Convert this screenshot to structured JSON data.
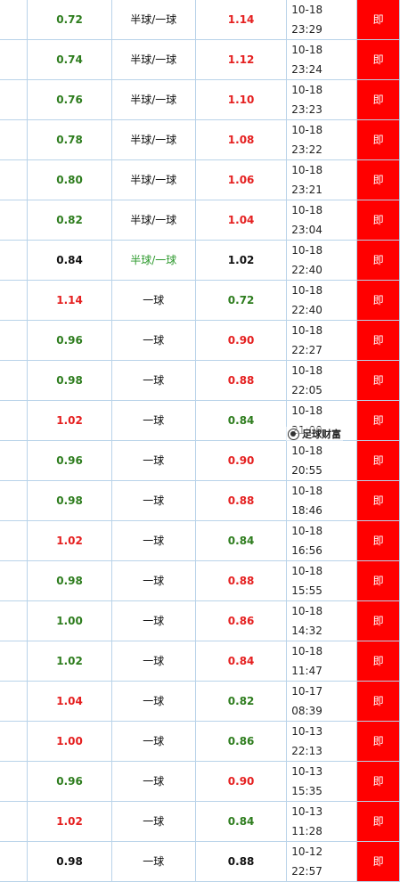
{
  "rows": [
    {
      "home": "0.72",
      "home_color": "green",
      "handicap": "半球/一球",
      "handicap_color": "black",
      "away": "1.14",
      "away_color": "red",
      "time": "10-18 23:29",
      "action": "即"
    },
    {
      "home": "0.74",
      "home_color": "green",
      "handicap": "半球/一球",
      "handicap_color": "black",
      "away": "1.12",
      "away_color": "red",
      "time": "10-18 23:24",
      "action": "即"
    },
    {
      "home": "0.76",
      "home_color": "green",
      "handicap": "半球/一球",
      "handicap_color": "black",
      "away": "1.10",
      "away_color": "red",
      "time": "10-18 23:23",
      "action": "即"
    },
    {
      "home": "0.78",
      "home_color": "green",
      "handicap": "半球/一球",
      "handicap_color": "black",
      "away": "1.08",
      "away_color": "red",
      "time": "10-18 23:22",
      "action": "即"
    },
    {
      "home": "0.80",
      "home_color": "green",
      "handicap": "半球/一球",
      "handicap_color": "black",
      "away": "1.06",
      "away_color": "red",
      "time": "10-18 23:21",
      "action": "即"
    },
    {
      "home": "0.82",
      "home_color": "green",
      "handicap": "半球/一球",
      "handicap_color": "black",
      "away": "1.04",
      "away_color": "red",
      "time": "10-18 23:04",
      "action": "即"
    },
    {
      "home": "0.84",
      "home_color": "black",
      "handicap": "半球/一球",
      "handicap_color": "green",
      "away": "1.02",
      "away_color": "black",
      "time": "10-18 22:40",
      "action": "即"
    },
    {
      "home": "1.14",
      "home_color": "red",
      "handicap": "一球",
      "handicap_color": "black",
      "away": "0.72",
      "away_color": "green",
      "time": "10-18 22:40",
      "action": "即"
    },
    {
      "home": "0.96",
      "home_color": "green",
      "handicap": "一球",
      "handicap_color": "black",
      "away": "0.90",
      "away_color": "red",
      "time": "10-18 22:27",
      "action": "即"
    },
    {
      "home": "0.98",
      "home_color": "green",
      "handicap": "一球",
      "handicap_color": "black",
      "away": "0.88",
      "away_color": "red",
      "time": "10-18 22:05",
      "action": "即"
    },
    {
      "home": "1.02",
      "home_color": "red",
      "handicap": "一球",
      "handicap_color": "black",
      "away": "0.84",
      "away_color": "green",
      "time": "10-18 21:00",
      "action": "即"
    },
    {
      "home": "0.96",
      "home_color": "green",
      "handicap": "一球",
      "handicap_color": "black",
      "away": "0.90",
      "away_color": "red",
      "time": "10-18 20:55",
      "action": "即"
    },
    {
      "home": "0.98",
      "home_color": "green",
      "handicap": "一球",
      "handicap_color": "black",
      "away": "0.88",
      "away_color": "red",
      "time": "10-18 18:46",
      "action": "即"
    },
    {
      "home": "1.02",
      "home_color": "red",
      "handicap": "一球",
      "handicap_color": "black",
      "away": "0.84",
      "away_color": "green",
      "time": "10-18 16:56",
      "action": "即"
    },
    {
      "home": "0.98",
      "home_color": "green",
      "handicap": "一球",
      "handicap_color": "black",
      "away": "0.88",
      "away_color": "red",
      "time": "10-18 15:55",
      "action": "即"
    },
    {
      "home": "1.00",
      "home_color": "green",
      "handicap": "一球",
      "handicap_color": "black",
      "away": "0.86",
      "away_color": "red",
      "time": "10-18 14:32",
      "action": "即"
    },
    {
      "home": "1.02",
      "home_color": "green",
      "handicap": "一球",
      "handicap_color": "black",
      "away": "0.84",
      "away_color": "red",
      "time": "10-18 11:47",
      "action": "即"
    },
    {
      "home": "1.04",
      "home_color": "red",
      "handicap": "一球",
      "handicap_color": "black",
      "away": "0.82",
      "away_color": "green",
      "time": "10-17 08:39",
      "action": "即"
    },
    {
      "home": "1.00",
      "home_color": "red",
      "handicap": "一球",
      "handicap_color": "black",
      "away": "0.86",
      "away_color": "green",
      "time": "10-13 22:13",
      "action": "即"
    },
    {
      "home": "0.96",
      "home_color": "green",
      "handicap": "一球",
      "handicap_color": "black",
      "away": "0.90",
      "away_color": "red",
      "time": "10-13 15:35",
      "action": "即"
    },
    {
      "home": "1.02",
      "home_color": "red",
      "handicap": "一球",
      "handicap_color": "black",
      "away": "0.84",
      "away_color": "green",
      "time": "10-13 11:28",
      "action": "即"
    },
    {
      "home": "0.98",
      "home_color": "black",
      "handicap": "一球",
      "handicap_color": "black",
      "away": "0.88",
      "away_color": "black",
      "time": "10-12 22:57",
      "action": "即"
    }
  ],
  "watermark": {
    "text": "足球财富",
    "icon": "logo-icon"
  },
  "colors": {
    "green": "#2e7d1e",
    "red": "#e52020",
    "black": "#111111",
    "action_bg": "#ff0000",
    "border": "#b9d3e9"
  }
}
